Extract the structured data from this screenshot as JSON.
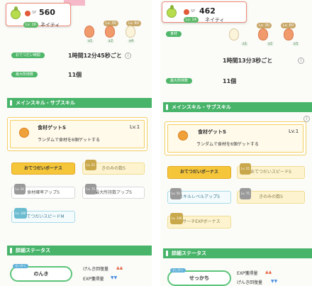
{
  "left": {
    "header": {
      "cp_label": "SP",
      "cp_value": "560",
      "lv": "Lv. 16",
      "nature": "ネイティ"
    },
    "ingredients": {
      "lv_tags": [
        "Lv. 30",
        "Lv. 60"
      ],
      "counts": [
        "x1",
        "x2",
        "x4"
      ]
    },
    "help_label": "おてつだい時間",
    "help_value": "1時間12分45秒ごと",
    "max_label": "最大所持数",
    "max_value": "11個",
    "section_skills": "メインスキル・サブスキル",
    "skill": {
      "name": "食材ゲットS",
      "lv": "Lv.1",
      "desc": "ランダムで食材を6個ゲットする"
    },
    "subskills": [
      {
        "lv": "",
        "label": "おてつだいボーナス"
      },
      {
        "lv": "Lv. 25",
        "label": "きのみの数S"
      },
      {
        "lv": "Lv. 50",
        "label": "食材確率アップS"
      },
      {
        "lv": "Lv. 75",
        "label": "最大所持数アップS"
      },
      {
        "lv": "Lv. 100",
        "label": "おてつだいスピードM"
      }
    ],
    "section_stats": "詳細ステータス",
    "nature_tag": "せいかく",
    "nature_name": "のんき",
    "stat_up": "げんき回復量",
    "stat_down": "EXP獲得量"
  },
  "right": {
    "header": {
      "cp_label": "SP",
      "cp_value": "462",
      "lv": "Lv. 14",
      "nature": "ネイティ"
    },
    "ingredients": {
      "lv_tags": [
        "Lv. 30",
        "Lv. 60"
      ],
      "counts": [
        "x1",
        "x2",
        "x3"
      ]
    },
    "help_label": "食材",
    "help_value": "1時間13分3秒ごと",
    "max_label": "最大所持数",
    "max_value": "11個",
    "section_skills": "メインスキル・サブスキル",
    "skill": {
      "name": "食材ゲットS",
      "lv": "Lv.1",
      "desc": "ランダムで食材を6個ゲットする"
    },
    "subskills": [
      {
        "lv": "",
        "label": "おてつだいボーナス"
      },
      {
        "lv": "Lv. 25",
        "label": "おてつだいスピードS"
      },
      {
        "lv": "Lv. 50",
        "label": "スキルレベルアップS"
      },
      {
        "lv": "Lv. 75",
        "label": "きのみの数S"
      },
      {
        "lv": "Lv. 100",
        "label": "リサーチEXPボーナス"
      }
    ],
    "section_stats": "詳細ステータス",
    "nature_tag": "せいかく",
    "nature_name": "せっかち",
    "stat_up": "EXP獲得量",
    "stat_down": "げんき回復量"
  },
  "glyphs": {
    "info": "i",
    "up": "▲▲",
    "down": "▼▼"
  }
}
